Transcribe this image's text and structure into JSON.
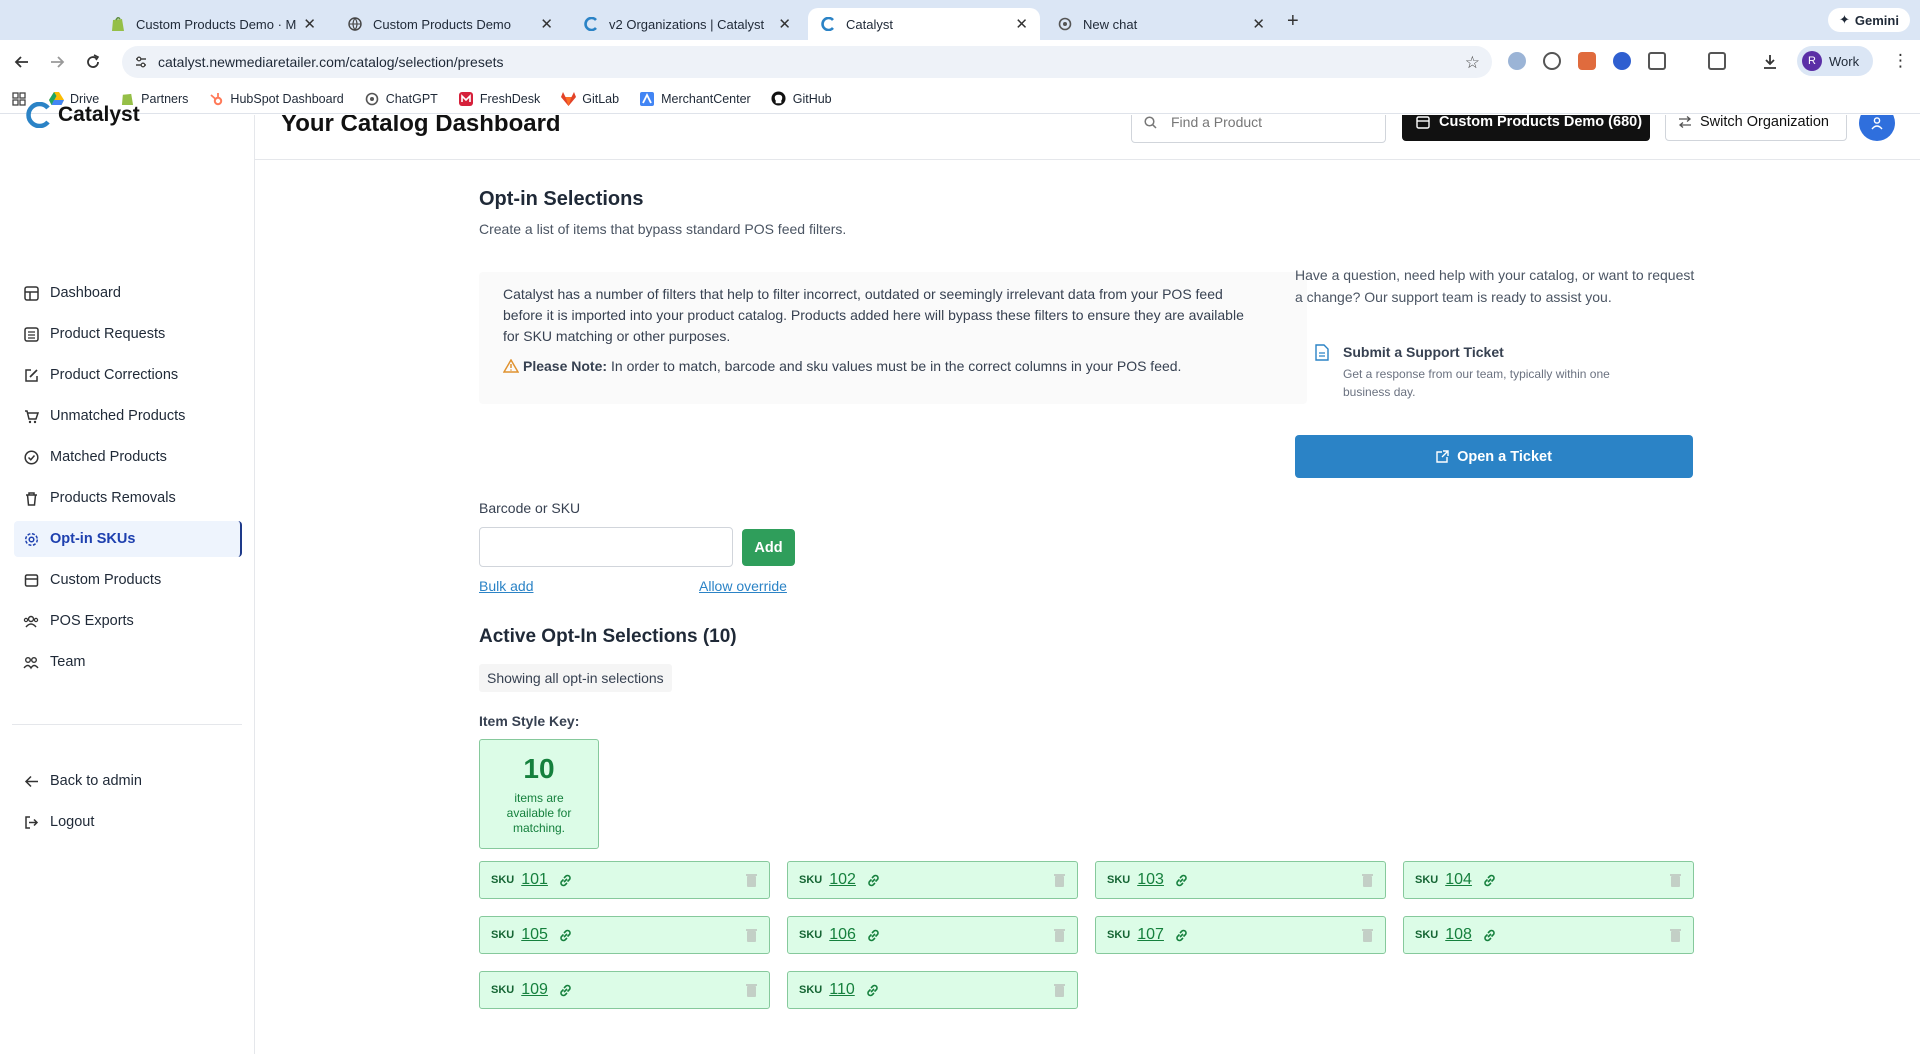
{
  "browser": {
    "tabs": [
      {
        "title": "Custom Products Demo · Me",
        "icon": "shopify-icon"
      },
      {
        "title": "Custom Products Demo",
        "icon": "globe-icon"
      },
      {
        "title": "v2 Organizations | Catalyst",
        "icon": "catalyst-icon"
      },
      {
        "title": "Catalyst",
        "icon": "catalyst-icon",
        "active": true
      },
      {
        "title": "New chat",
        "icon": "chatgpt-icon"
      }
    ],
    "gemini_label": "Gemini",
    "url": "catalyst.newmediaretailer.com/catalog/selection/presets",
    "profile_initial": "R",
    "profile_label": "Work",
    "bookmarks": [
      {
        "label": "Drive",
        "icon": "drive-icon"
      },
      {
        "label": "Partners",
        "icon": "shopify-icon"
      },
      {
        "label": "HubSpot Dashboard",
        "icon": "hubspot-icon"
      },
      {
        "label": "ChatGPT",
        "icon": "chatgpt-icon"
      },
      {
        "label": "FreshDesk",
        "icon": "freshdesk-icon"
      },
      {
        "label": "GitLab",
        "icon": "gitlab-icon"
      },
      {
        "label": "MerchantCenter",
        "icon": "merchantcenter-icon"
      },
      {
        "label": "GitHub",
        "icon": "github-icon"
      }
    ]
  },
  "app": {
    "logo_text": "Catalyst",
    "header_title": "Your Catalog Dashboard",
    "search_placeholder": "Find a Product",
    "org_button": "Custom Products Demo (680)",
    "switch_org": "Switch Organization"
  },
  "sidebar": {
    "items": [
      {
        "label": "Dashboard",
        "icon": "dashboard-icon"
      },
      {
        "label": "Product Requests",
        "icon": "list-icon"
      },
      {
        "label": "Product Corrections",
        "icon": "edit-icon"
      },
      {
        "label": "Unmatched Products",
        "icon": "cart-icon"
      },
      {
        "label": "Matched Products",
        "icon": "check-circle-icon"
      },
      {
        "label": "Products Removals",
        "icon": "trash-icon"
      },
      {
        "label": "Opt-in SKUs",
        "icon": "gear-icon",
        "active": true
      },
      {
        "label": "Custom Products",
        "icon": "box-icon"
      },
      {
        "label": "POS Exports",
        "icon": "users-icon"
      },
      {
        "label": "Team",
        "icon": "team-icon"
      }
    ],
    "back": "Back to admin",
    "logout": "Logout"
  },
  "page": {
    "title": "Opt-in Selections",
    "subtitle": "Create a list of items that bypass standard POS feed filters.",
    "info_text": "Catalyst has a number of filters that help to filter incorrect, outdated or seemingly irrelevant data from your POS feed before it is imported into your product catalog. Products added here will bypass these filters to ensure they are available for SKU matching or other purposes.",
    "note_label": "Please Note:",
    "note_text": "In order to match, barcode and sku values must be in the correct columns in your POS feed.",
    "support_text": "Have a question, need help with your catalog, or want to request a change? Our support team is ready to assist you.",
    "support_title": "Submit a Support Ticket",
    "support_desc": "Get a response from our team, typically within one business day.",
    "open_ticket": "Open a Ticket",
    "input_label": "Barcode or SKU",
    "input_value": "",
    "add_button": "Add",
    "bulk_add": "Bulk add",
    "allow_override": "Allow override",
    "active_title": "Active Opt-In Selections (10)",
    "filter_chip": "Showing all opt-in selections",
    "style_key_label": "Item Style Key:",
    "key_count": "10",
    "key_text": "items are available for matching.",
    "sku_label": "SKU",
    "skus": [
      "101",
      "102",
      "103",
      "104",
      "105",
      "106",
      "107",
      "108",
      "109",
      "110"
    ]
  },
  "colors": {
    "primary": "#2b83c6",
    "add_green": "#2f9e5b",
    "sku_bg": "#dcfce7",
    "sku_border": "#86c99c",
    "org_button_bg": "#111111"
  }
}
